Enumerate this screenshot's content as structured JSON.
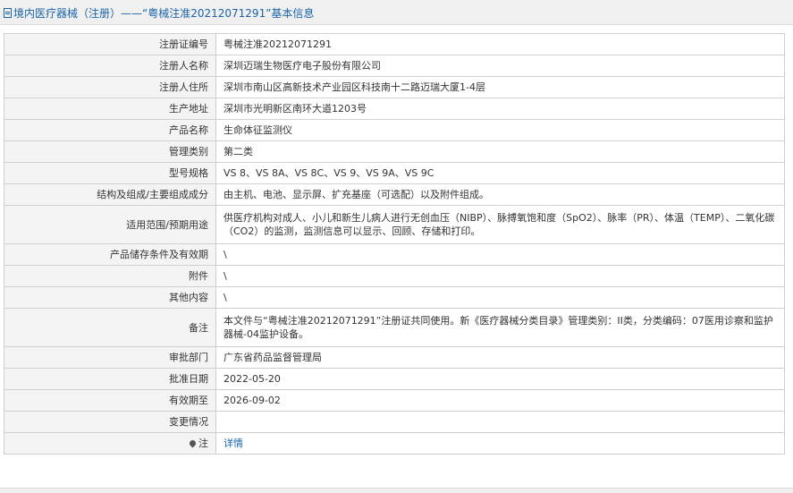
{
  "header": {
    "title": "境内医疗器械（注册）——“粤械注准20212071291”基本信息"
  },
  "rows": [
    {
      "label": "注册证编号",
      "value": "粤械注准20212071291"
    },
    {
      "label": "注册人名称",
      "value": "深圳迈瑞生物医疗电子股份有限公司"
    },
    {
      "label": "注册人住所",
      "value": "深圳市南山区高新技术产业园区科技南十二路迈瑞大厦1-4层"
    },
    {
      "label": "生产地址",
      "value": "深圳市光明新区南环大道1203号"
    },
    {
      "label": "产品名称",
      "value": "生命体征监测仪"
    },
    {
      "label": "管理类别",
      "value": "第二类"
    },
    {
      "label": "型号规格",
      "value": "VS 8、VS 8A、VS 8C、VS 9、VS 9A、VS 9C"
    },
    {
      "label": "结构及组成/主要组成成分",
      "value": "由主机、电池、显示屏、扩充基座（可选配）以及附件组成。"
    },
    {
      "label": "适用范围/预期用途",
      "value": "供医疗机构对成人、小儿和新生儿病人进行无创血压（NIBP）、脉搏氧饱和度（SpO2）、脉率（PR）、体温（TEMP）、二氧化碳（CO2）的监测，监测信息可以显示、回顾、存储和打印。"
    },
    {
      "label": "产品储存条件及有效期",
      "value": "\\"
    },
    {
      "label": "附件",
      "value": "\\"
    },
    {
      "label": "其他内容",
      "value": "\\"
    },
    {
      "label": "备注",
      "value": "本文件与“粤械注准20212071291”注册证共同使用。新《医疗器械分类目录》管理类别：II类，分类编码：07医用诊察和监护器械-04监护设备。"
    },
    {
      "label": "审批部门",
      "value": "广东省药品监督管理局"
    },
    {
      "label": "批准日期",
      "value": "2022-05-20"
    },
    {
      "label": "有效期至",
      "value": "2026-09-02"
    },
    {
      "label": "变更情况",
      "value": ""
    },
    {
      "label": "注",
      "value": "详情"
    }
  ],
  "icons": {
    "header": "document-icon",
    "note": "pin-icon"
  },
  "colors": {
    "link": "#1a63a8",
    "label_bg": "#f4f4f4",
    "border": "#cfcfcf"
  }
}
